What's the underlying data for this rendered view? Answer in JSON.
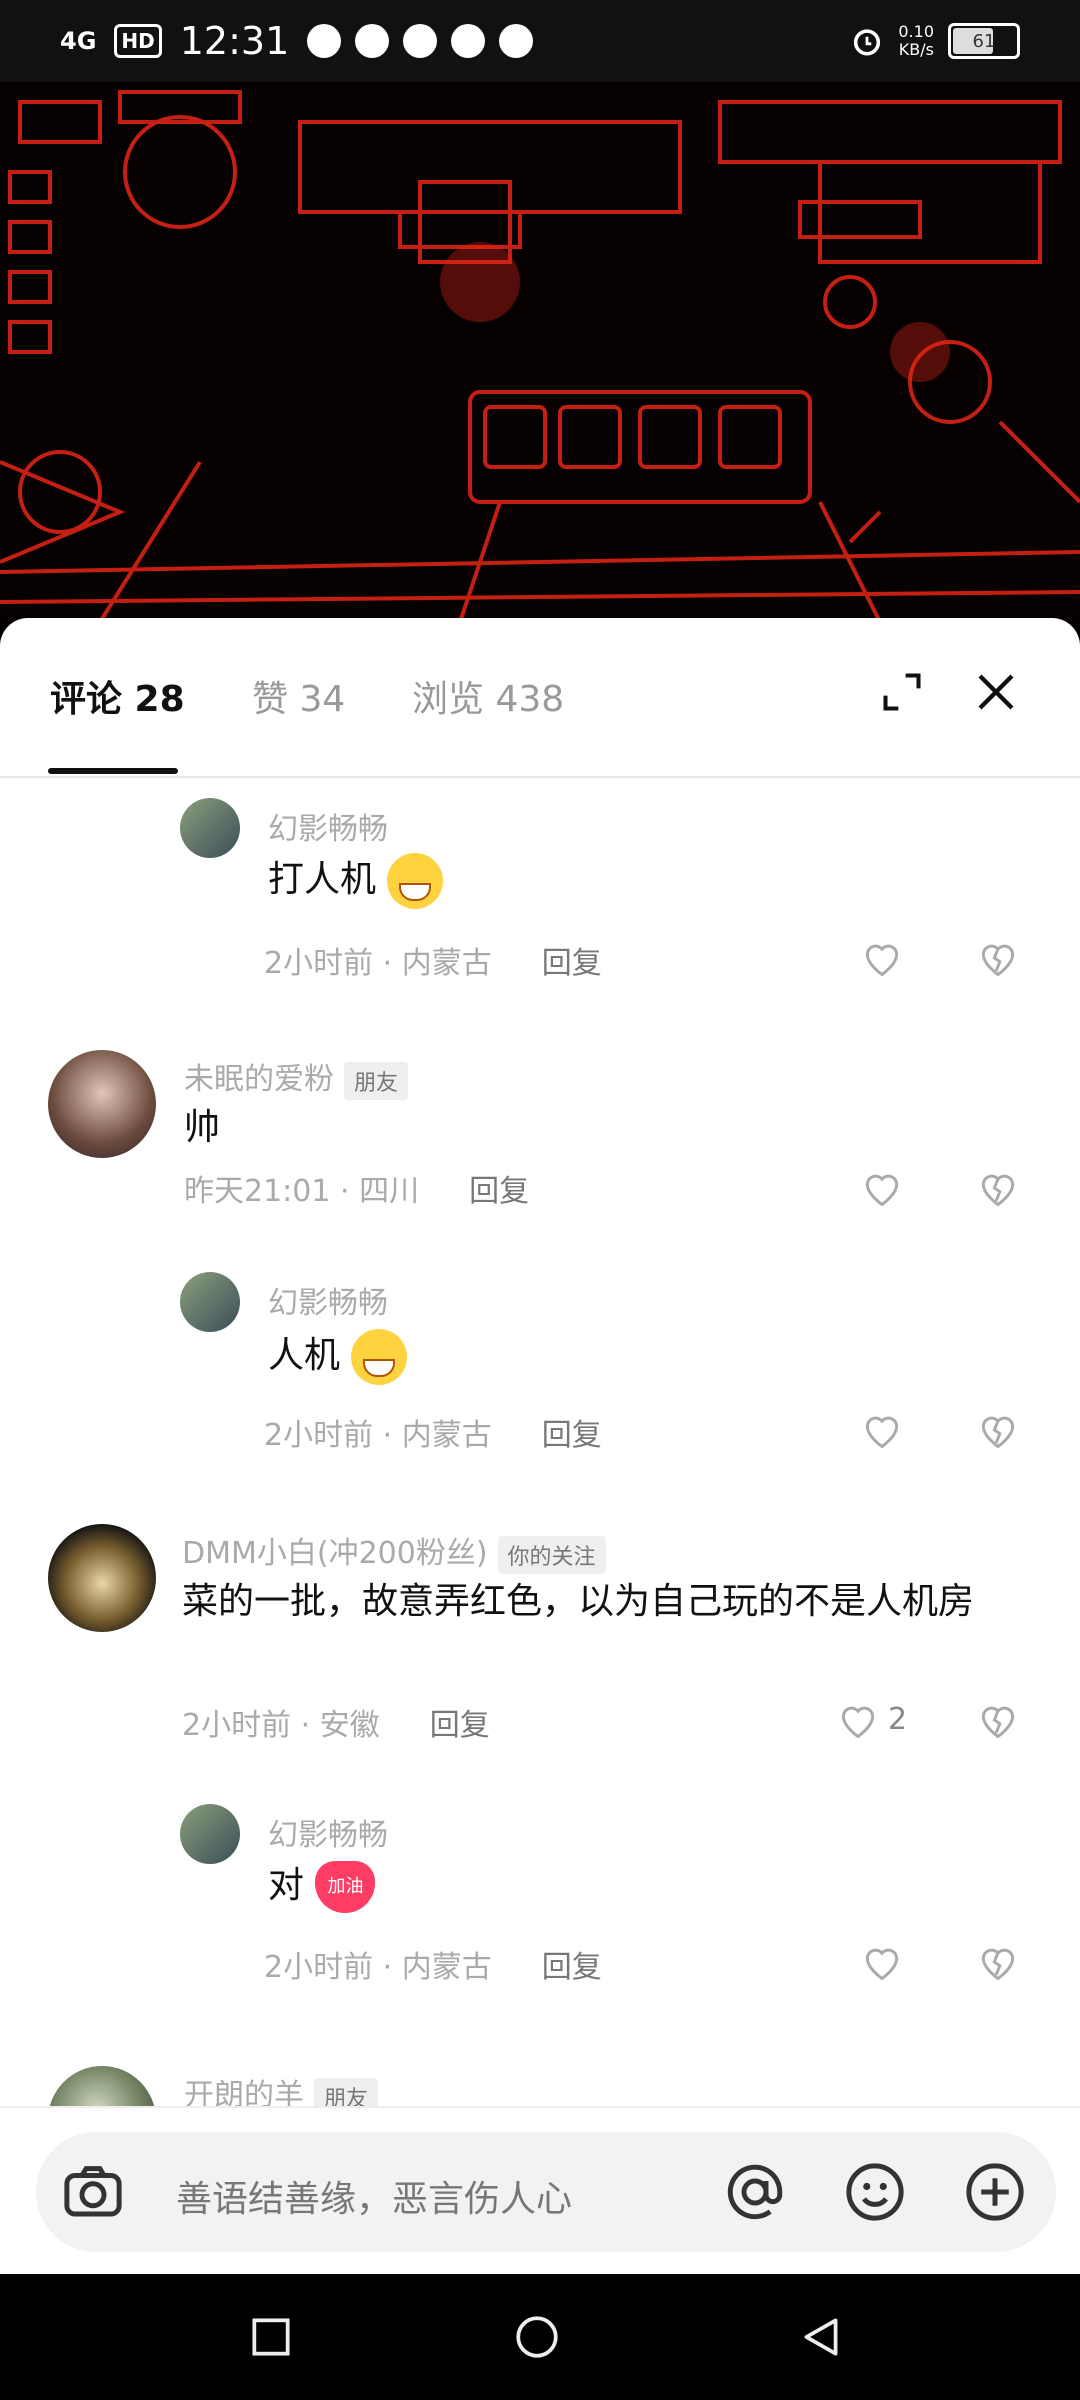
{
  "status": {
    "network": "4G",
    "hd": "HD",
    "time": "12:31",
    "speed_value": "0.10",
    "speed_unit": "KB/s",
    "battery": "61"
  },
  "tabs": [
    {
      "label": "评论 28"
    },
    {
      "label": "赞 34"
    },
    {
      "label": "浏览 438"
    }
  ],
  "comments": [
    {
      "user": "幻影畅畅",
      "text": "打人机",
      "meta": "2小时前 · 内蒙古",
      "reply": "回复"
    },
    {
      "user": "未眠的爱粉",
      "badge": "朋友",
      "text": "帅",
      "meta": "昨天21:01 · 四川",
      "reply": "回复"
    },
    {
      "user": "幻影畅畅",
      "text": "人机",
      "meta": "2小时前 · 内蒙古",
      "reply": "回复"
    },
    {
      "user": "DMM小白(冲200粉丝)",
      "badge": "你的关注",
      "text": "菜的一批，故意弄红色，以为自己玩的不是人机房",
      "meta": "2小时前 · 安徽",
      "reply": "回复",
      "likes": "2"
    },
    {
      "user": "幻影畅畅",
      "text": "对",
      "meta": "2小时前 · 内蒙古",
      "reply": "回复",
      "emoji_label": "加油"
    },
    {
      "user": "开朗的羊",
      "badge": "朋友"
    }
  ],
  "input": {
    "placeholder": "善语结善缘，恶言伤人心"
  },
  "icons": {
    "expand": "expand-icon",
    "close": "close-icon",
    "camera": "camera-icon",
    "at": "at-icon",
    "emoji": "emoji-icon",
    "add": "add-icon"
  }
}
